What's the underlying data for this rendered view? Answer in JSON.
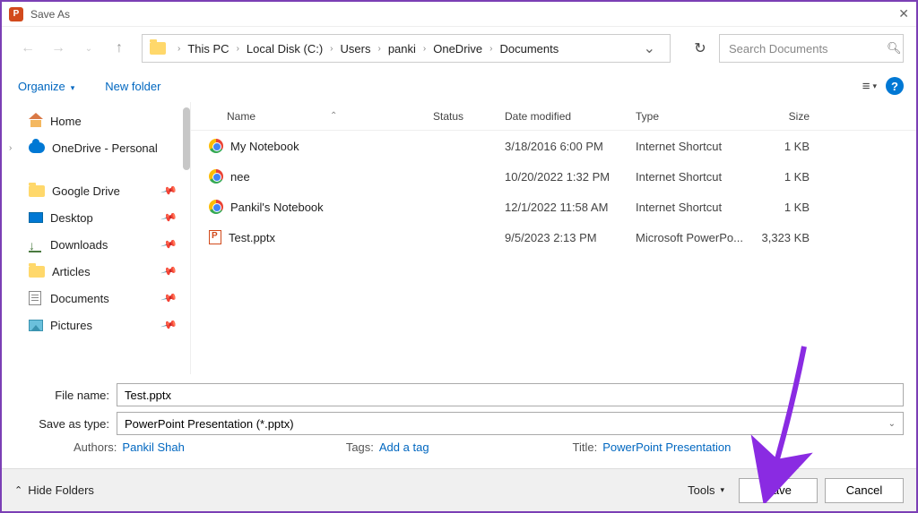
{
  "window": {
    "title": "Save As"
  },
  "breadcrumbs": [
    "This PC",
    "Local Disk (C:)",
    "Users",
    "panki",
    "OneDrive",
    "Documents"
  ],
  "search": {
    "placeholder": "Search Documents"
  },
  "toolbar": {
    "organize": "Organize",
    "new_folder": "New folder"
  },
  "tree": {
    "home": "Home",
    "onedrive": "OneDrive - Personal",
    "quick": [
      "Google Drive",
      "Desktop",
      "Downloads",
      "Articles",
      "Documents",
      "Pictures"
    ]
  },
  "columns": {
    "name": "Name",
    "status": "Status",
    "date": "Date modified",
    "type": "Type",
    "size": "Size"
  },
  "files": [
    {
      "name": "My Notebook",
      "date": "3/18/2016 6:00 PM",
      "type": "Internet Shortcut",
      "size": "1 KB",
      "icon": "chrome"
    },
    {
      "name": "nee",
      "date": "10/20/2022 1:32 PM",
      "type": "Internet Shortcut",
      "size": "1 KB",
      "icon": "chrome"
    },
    {
      "name": "Pankil's Notebook",
      "date": "12/1/2022 11:58 AM",
      "type": "Internet Shortcut",
      "size": "1 KB",
      "icon": "chrome"
    },
    {
      "name": "Test.pptx",
      "date": "9/5/2023 2:13 PM",
      "type": "Microsoft PowerPo...",
      "size": "3,323 KB",
      "icon": "ppt"
    }
  ],
  "form": {
    "filename_label": "File name:",
    "filename_value": "Test.pptx",
    "saveastype_label": "Save as type:",
    "saveastype_value": "PowerPoint Presentation (*.pptx)",
    "authors_label": "Authors:",
    "authors_value": "Pankil Shah",
    "tags_label": "Tags:",
    "tags_value": "Add a tag",
    "title_label": "Title:",
    "title_value": "PowerPoint Presentation"
  },
  "footer": {
    "hide_folders": "Hide Folders",
    "tools": "Tools",
    "save": "Save",
    "cancel": "Cancel"
  }
}
